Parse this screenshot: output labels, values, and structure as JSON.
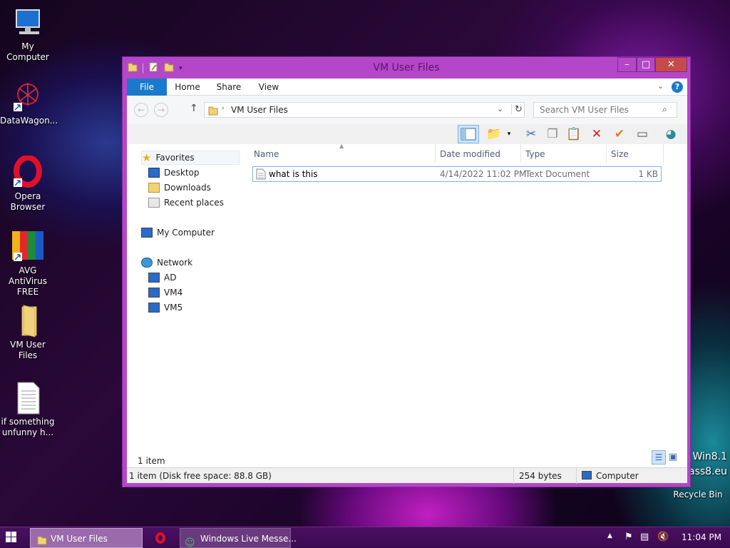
{
  "desktop": {
    "icons": [
      {
        "label": "My Computer",
        "icon": "monitor-icon"
      },
      {
        "label": "DataWagon...",
        "icon": "datawagon-icon"
      },
      {
        "label": "Opera Browser",
        "icon": "opera-icon"
      },
      {
        "label": "AVG AntiVirus FREE",
        "icon": "avg-icon"
      },
      {
        "label": "VM User Files",
        "icon": "folder-icon"
      },
      {
        "label": "if something unfunny h...",
        "icon": "text-file-icon"
      },
      {
        "label": "Recycle Bin",
        "icon": "recycle-bin-icon"
      }
    ],
    "watermark_line1": "Win8.1",
    "watermark_line2": "ass8.eu"
  },
  "window": {
    "title": "VM User Files",
    "controls": {
      "minimize": "–",
      "maximize": "□",
      "close": "✕"
    },
    "ribbon_tabs": [
      "File",
      "Home",
      "Share",
      "View"
    ],
    "address": {
      "path": "VM User Files",
      "search_placeholder": "Search VM User Files"
    },
    "nav": {
      "favorites": "Favorites",
      "favorites_items": [
        "Desktop",
        "Downloads",
        "Recent places"
      ],
      "computer": "My Computer",
      "network": "Network",
      "network_items": [
        "AD",
        "VM4",
        "VM5"
      ]
    },
    "columns": [
      "Name",
      "Date modified",
      "Type",
      "Size"
    ],
    "files": [
      {
        "name": "what is this",
        "date": "4/14/2022 11:02 PM",
        "type": "Text Document",
        "size": "1 KB"
      }
    ],
    "item_count": "1 item",
    "status": {
      "left": "1 item (Disk free space: 88.8 GB)",
      "size": "254 bytes",
      "location": "Computer"
    }
  },
  "taskbar": {
    "buttons": [
      {
        "label": "VM User Files",
        "icon": "folder-icon"
      },
      {
        "label": "",
        "icon": "opera-icon"
      },
      {
        "label": "Windows Live Messe...",
        "icon": "messenger-icon"
      }
    ],
    "clock": "11:04 PM",
    "tray_chevron": "▲"
  },
  "colors": {
    "accent": "#b347c8",
    "file_tab": "#1979ca",
    "taskbar": "#4a1060"
  }
}
